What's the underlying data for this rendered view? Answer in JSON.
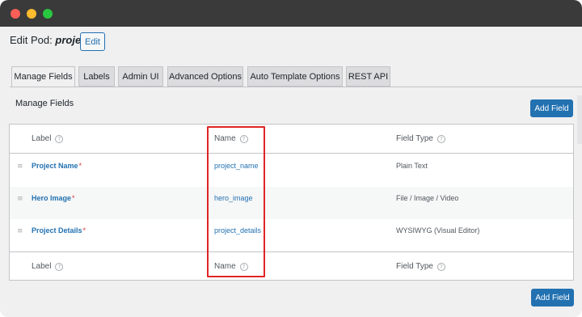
{
  "header": {
    "title_prefix": "Edit Pod:",
    "pod_name": "project",
    "edit_label": "Edit"
  },
  "tabs": [
    {
      "label": "Manage Fields",
      "active": true
    },
    {
      "label": "Labels",
      "active": false
    },
    {
      "label": "Admin UI",
      "active": false
    },
    {
      "label": "Advanced Options",
      "active": false
    },
    {
      "label": "Auto Template Options",
      "active": false
    },
    {
      "label": "REST API",
      "active": false
    }
  ],
  "section": {
    "title": "Manage Fields",
    "add_field_label": "Add Field"
  },
  "table": {
    "columns": {
      "label": "Label",
      "name": "Name",
      "field_type": "Field Type"
    },
    "help_glyph": "?",
    "required_marker": "*",
    "rows": [
      {
        "label": "Project Name",
        "name": "project_name",
        "type": "Plain Text"
      },
      {
        "label": "Hero Image",
        "name": "hero_image",
        "type": "File / Image / Video"
      },
      {
        "label": "Project Details",
        "name": "project_details",
        "type": "WYSIWYG (Visual Editor)"
      }
    ]
  },
  "colors": {
    "accent": "#2271b1",
    "highlight": "#e02424",
    "required": "#d63638"
  },
  "icons": {
    "help": "help-circle-icon",
    "drag": "drag-handle-icon"
  }
}
